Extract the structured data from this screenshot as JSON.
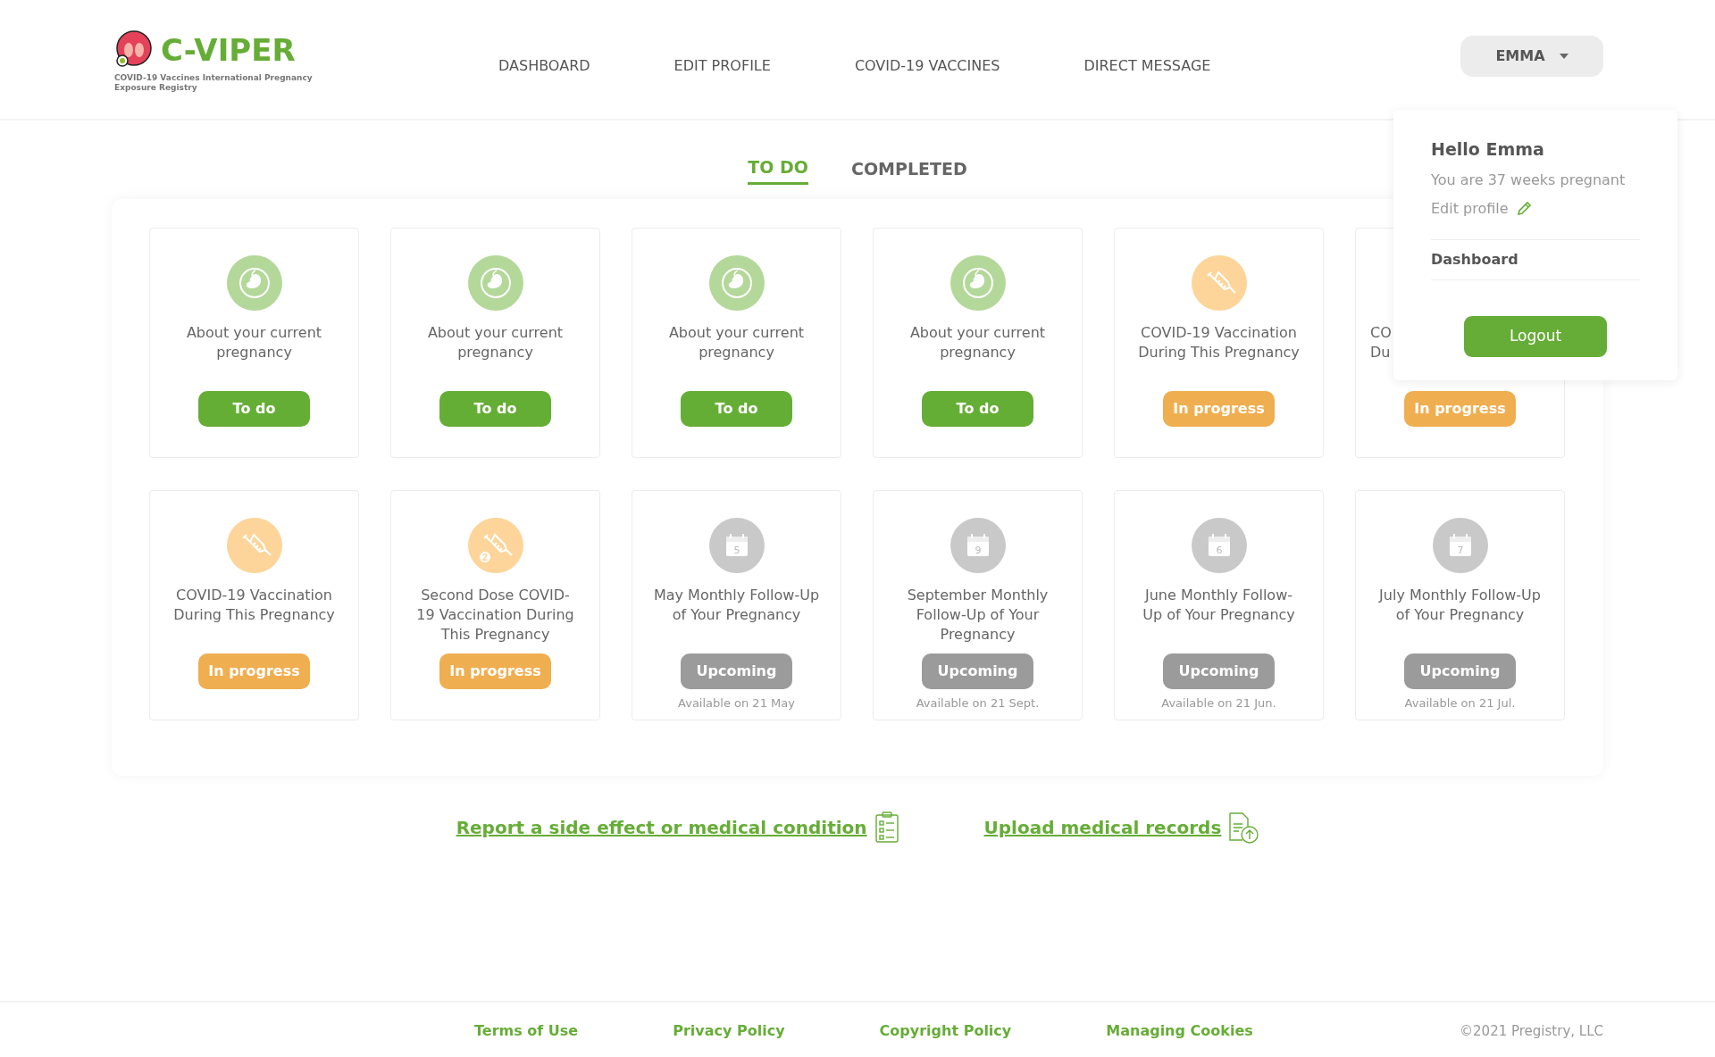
{
  "logo": {
    "name": "C-VIPER",
    "subtitle": "COVID-19 Vaccines International Pregnancy Exposure Registry"
  },
  "nav": [
    "DASHBOARD",
    "EDIT PROFILE",
    "COVID-19 VACCINES",
    "DIRECT MESSAGE"
  ],
  "user_menu": {
    "label": "EMMA",
    "expanded": true,
    "greeting": "Hello Emma",
    "status": "You are 37 weeks pregnant",
    "edit_link": "Edit profile",
    "items": [
      "Dashboard"
    ],
    "logout": "Logout"
  },
  "tabs": [
    {
      "label": "TO DO",
      "selected": true
    },
    {
      "label": "COMPLETED",
      "selected": false
    }
  ],
  "cards": [
    {
      "kind": "fetus",
      "title": "About your current pregnancy",
      "status": "To do",
      "color": "#65ae35"
    },
    {
      "kind": "fetus",
      "title": "About your current pregnancy",
      "status": "To do",
      "color": "#65ae35"
    },
    {
      "kind": "fetus",
      "title": "About your current pregnancy",
      "status": "To do",
      "color": "#65ae35"
    },
    {
      "kind": "fetus",
      "title": "About your current pregnancy",
      "status": "To do",
      "color": "#65ae35"
    },
    {
      "kind": "syringe",
      "title": "COVID-19 Vaccination During This Pregnancy",
      "status": "In progress",
      "color": "#efae50"
    },
    {
      "kind": "hidden",
      "title": "CO Du",
      "status": "In progress",
      "color": "#efae50"
    },
    {
      "kind": "syringe",
      "title": "COVID-19 Vaccination During This Pregnancy",
      "status": "In progress",
      "color": "#efae50"
    },
    {
      "kind": "syringe",
      "icon_text": "2",
      "title": "Second Dose COVID-19 Vaccination During This Pregnancy",
      "status": "In progress",
      "color": "#efae50"
    },
    {
      "kind": "calendar",
      "icon_text": "5",
      "title": "May Monthly Follow-Up of Your Pregnancy",
      "status": "Upcoming",
      "color": "#9b9b9b",
      "note": "Available on 21 May"
    },
    {
      "kind": "calendar",
      "icon_text": "9",
      "title": "September Monthly Follow-Up of Your Pregnancy",
      "status": "Upcoming",
      "color": "#9b9b9b",
      "note": "Available on 21 Sept."
    },
    {
      "kind": "calendar",
      "icon_text": "6",
      "title": "June Monthly Follow-Up of Your Pregnancy",
      "status": "Upcoming",
      "color": "#9b9b9b",
      "note": "Available on 21 Jun."
    },
    {
      "kind": "calendar",
      "icon_text": "7",
      "title": "July Monthly Follow-Up of Your Pregnancy",
      "status": "Upcoming",
      "color": "#9b9b9b",
      "note": "Available on 21 Jul."
    }
  ],
  "actions": [
    {
      "label": "Report a side effect or medical condition",
      "kind": "clipboard"
    },
    {
      "label": "Upload medical records",
      "kind": "upload"
    }
  ],
  "footer": {
    "links": [
      "Terms of Use",
      "Privacy Policy",
      "Copyright Policy",
      "Managing Cookies"
    ],
    "copyright": "©2021 Pregistry, LLC"
  }
}
